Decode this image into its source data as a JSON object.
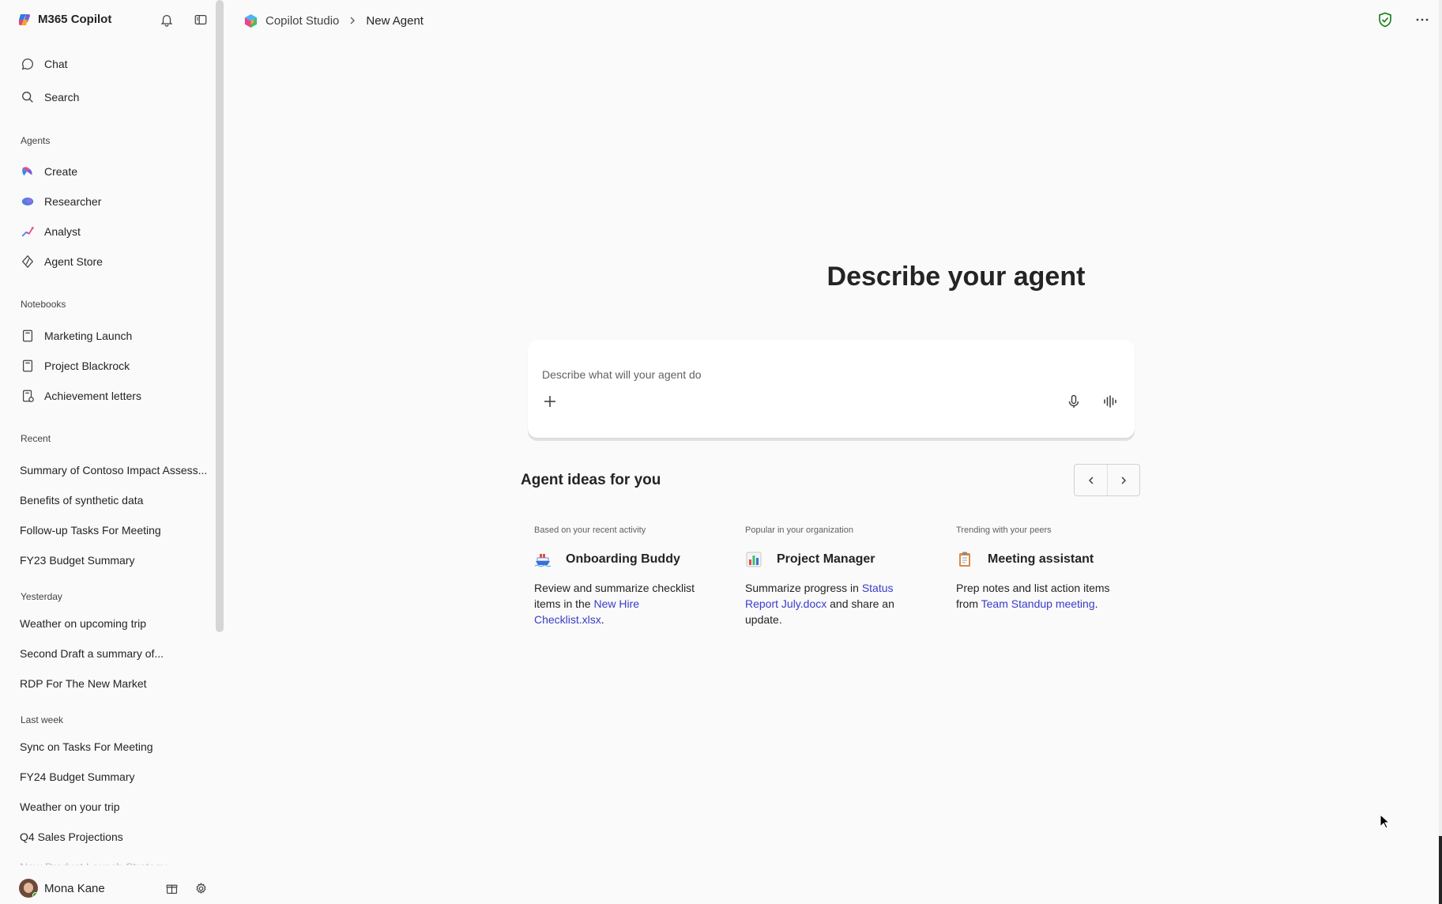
{
  "app": {
    "title": "M365 Copilot"
  },
  "sidebar": {
    "nav": [
      {
        "label": "Chat",
        "icon": "chat-icon"
      },
      {
        "label": "Search",
        "icon": "search-icon"
      }
    ],
    "agents_header": "Agents",
    "agents": [
      {
        "label": "Create",
        "icon": "create-agent-icon"
      },
      {
        "label": "Researcher",
        "icon": "researcher-icon"
      },
      {
        "label": "Analyst",
        "icon": "analyst-icon"
      },
      {
        "label": "Agent Store",
        "icon": "agent-store-icon"
      }
    ],
    "notebooks_header": "Notebooks",
    "notebooks": [
      {
        "label": "Marketing Launch",
        "icon": "notebook-icon"
      },
      {
        "label": "Project Blackrock",
        "icon": "notebook-icon"
      },
      {
        "label": "Achievement letters",
        "icon": "notebook-shared-icon"
      }
    ],
    "recent_header": "Recent",
    "recent": [
      "Summary of Contoso Impact Assess...",
      "Benefits of synthetic data",
      "Follow-up Tasks For Meeting",
      "FY23 Budget Summary"
    ],
    "yesterday_header": "Yesterday",
    "yesterday": [
      "Weather on upcoming trip",
      "Second Draft a summary of...",
      "RDP For The New Market"
    ],
    "last_week_header": "Last week",
    "last_week": [
      "Sync on Tasks For Meeting",
      "FY24 Budget Summary",
      "Weather on your trip",
      "Q4 Sales Projections",
      "New Product Launch Strategy"
    ],
    "user": {
      "name": "Mona Kane",
      "presence": "available"
    }
  },
  "breadcrumb": {
    "root": "Copilot Studio",
    "current": "New Agent"
  },
  "main": {
    "title": "Describe your agent",
    "composer": {
      "placeholder": "Describe what will your agent do",
      "value": ""
    },
    "ideas_title": "Agent ideas for you",
    "ideas": [
      {
        "source": "Based on your recent activity",
        "name": "Onboarding Buddy",
        "icon": "ship-icon",
        "desc_before": "Review and summarize checklist items in the ",
        "link": "New Hire Checklist.xlsx",
        "desc_after": "."
      },
      {
        "source": "Popular in your organization",
        "name": "Project Manager",
        "icon": "bar-chart-icon",
        "desc_before": "Summarize progress in ",
        "link": "Status Report July.docx",
        "desc_after": " and share an update."
      },
      {
        "source": "Trending with your peers",
        "name": "Meeting assistant",
        "icon": "clipboard-icon",
        "desc_before": "Prep notes and list action items from ",
        "link": "Team Standup meeting",
        "desc_after": "."
      }
    ]
  },
  "colors": {
    "accent_link": "#3a3bc9",
    "shield_green": "#107c10",
    "background": "#fafafa"
  }
}
